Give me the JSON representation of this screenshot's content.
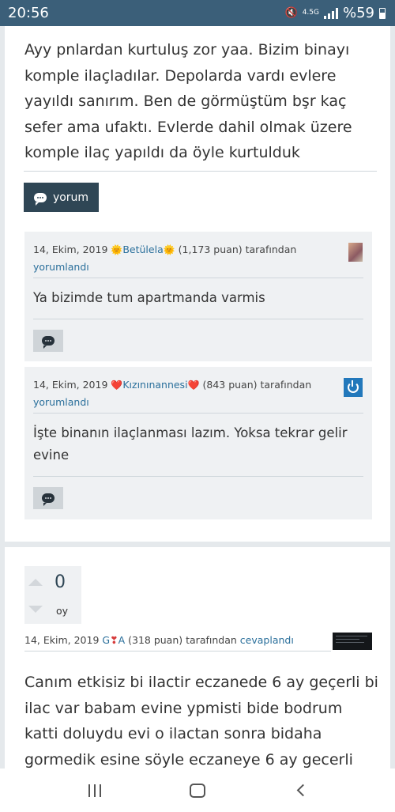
{
  "status_bar": {
    "time": "20:56",
    "network": "4.5G",
    "battery": "%59",
    "icons": [
      "mute-vibrate-icon",
      "signal-icon",
      "battery-icon"
    ]
  },
  "post_body": "Ayy pnlardan kurtuluş zor yaa. Bizim binayı komple ilaçladılar. Depolarda vardı evlere yayıldı sanırım. Ben de görmüştüm bşr kaç sefer ama ufaktı. Evlerde dahil olmak üzere komple ilaç yapıldı da öyle kurtulduk",
  "comment_button": {
    "label": "yorum",
    "icon": "comment-icon"
  },
  "comments": [
    {
      "date": "14, Ekim, 2019",
      "emoji_left": "🌞",
      "username": "Betülela",
      "emoji_right": "🌞",
      "points": "(1,173 puan)",
      "suffix": "tarafından",
      "action": "yorumlandı",
      "text": "Ya bizimde tum apartmanda varmis"
    },
    {
      "date": "14, Ekim, 2019",
      "emoji_left": "❤️",
      "username": "Kızınınannesi",
      "emoji_right": "❤️",
      "points": "(843 puan)",
      "suffix": "tarafından",
      "action": "yorumlandı",
      "text": "İşte binanın ilaçlanması lazım. Yoksa tekrar gelir evine"
    }
  ],
  "answer": {
    "votes": "0",
    "votes_label": "oy",
    "date": "14, Ekim, 2019",
    "username_1": "G",
    "username_emoji": "❣",
    "username_2": "A",
    "points": "(318 puan)",
    "suffix": "tarafından",
    "action": "cevaplandı",
    "text": "Canım etkisiz bi ilactir eczanede 6 ay geçerli bi ilac var babam evine ypmisti bide bodrum katti doluydu evi o ilactan sonra bidaha gormedik esine söyle eczaneye 6 ay gecerli"
  },
  "nav_bar": {
    "icons": [
      "recents-icon",
      "home-icon",
      "back-icon"
    ]
  }
}
